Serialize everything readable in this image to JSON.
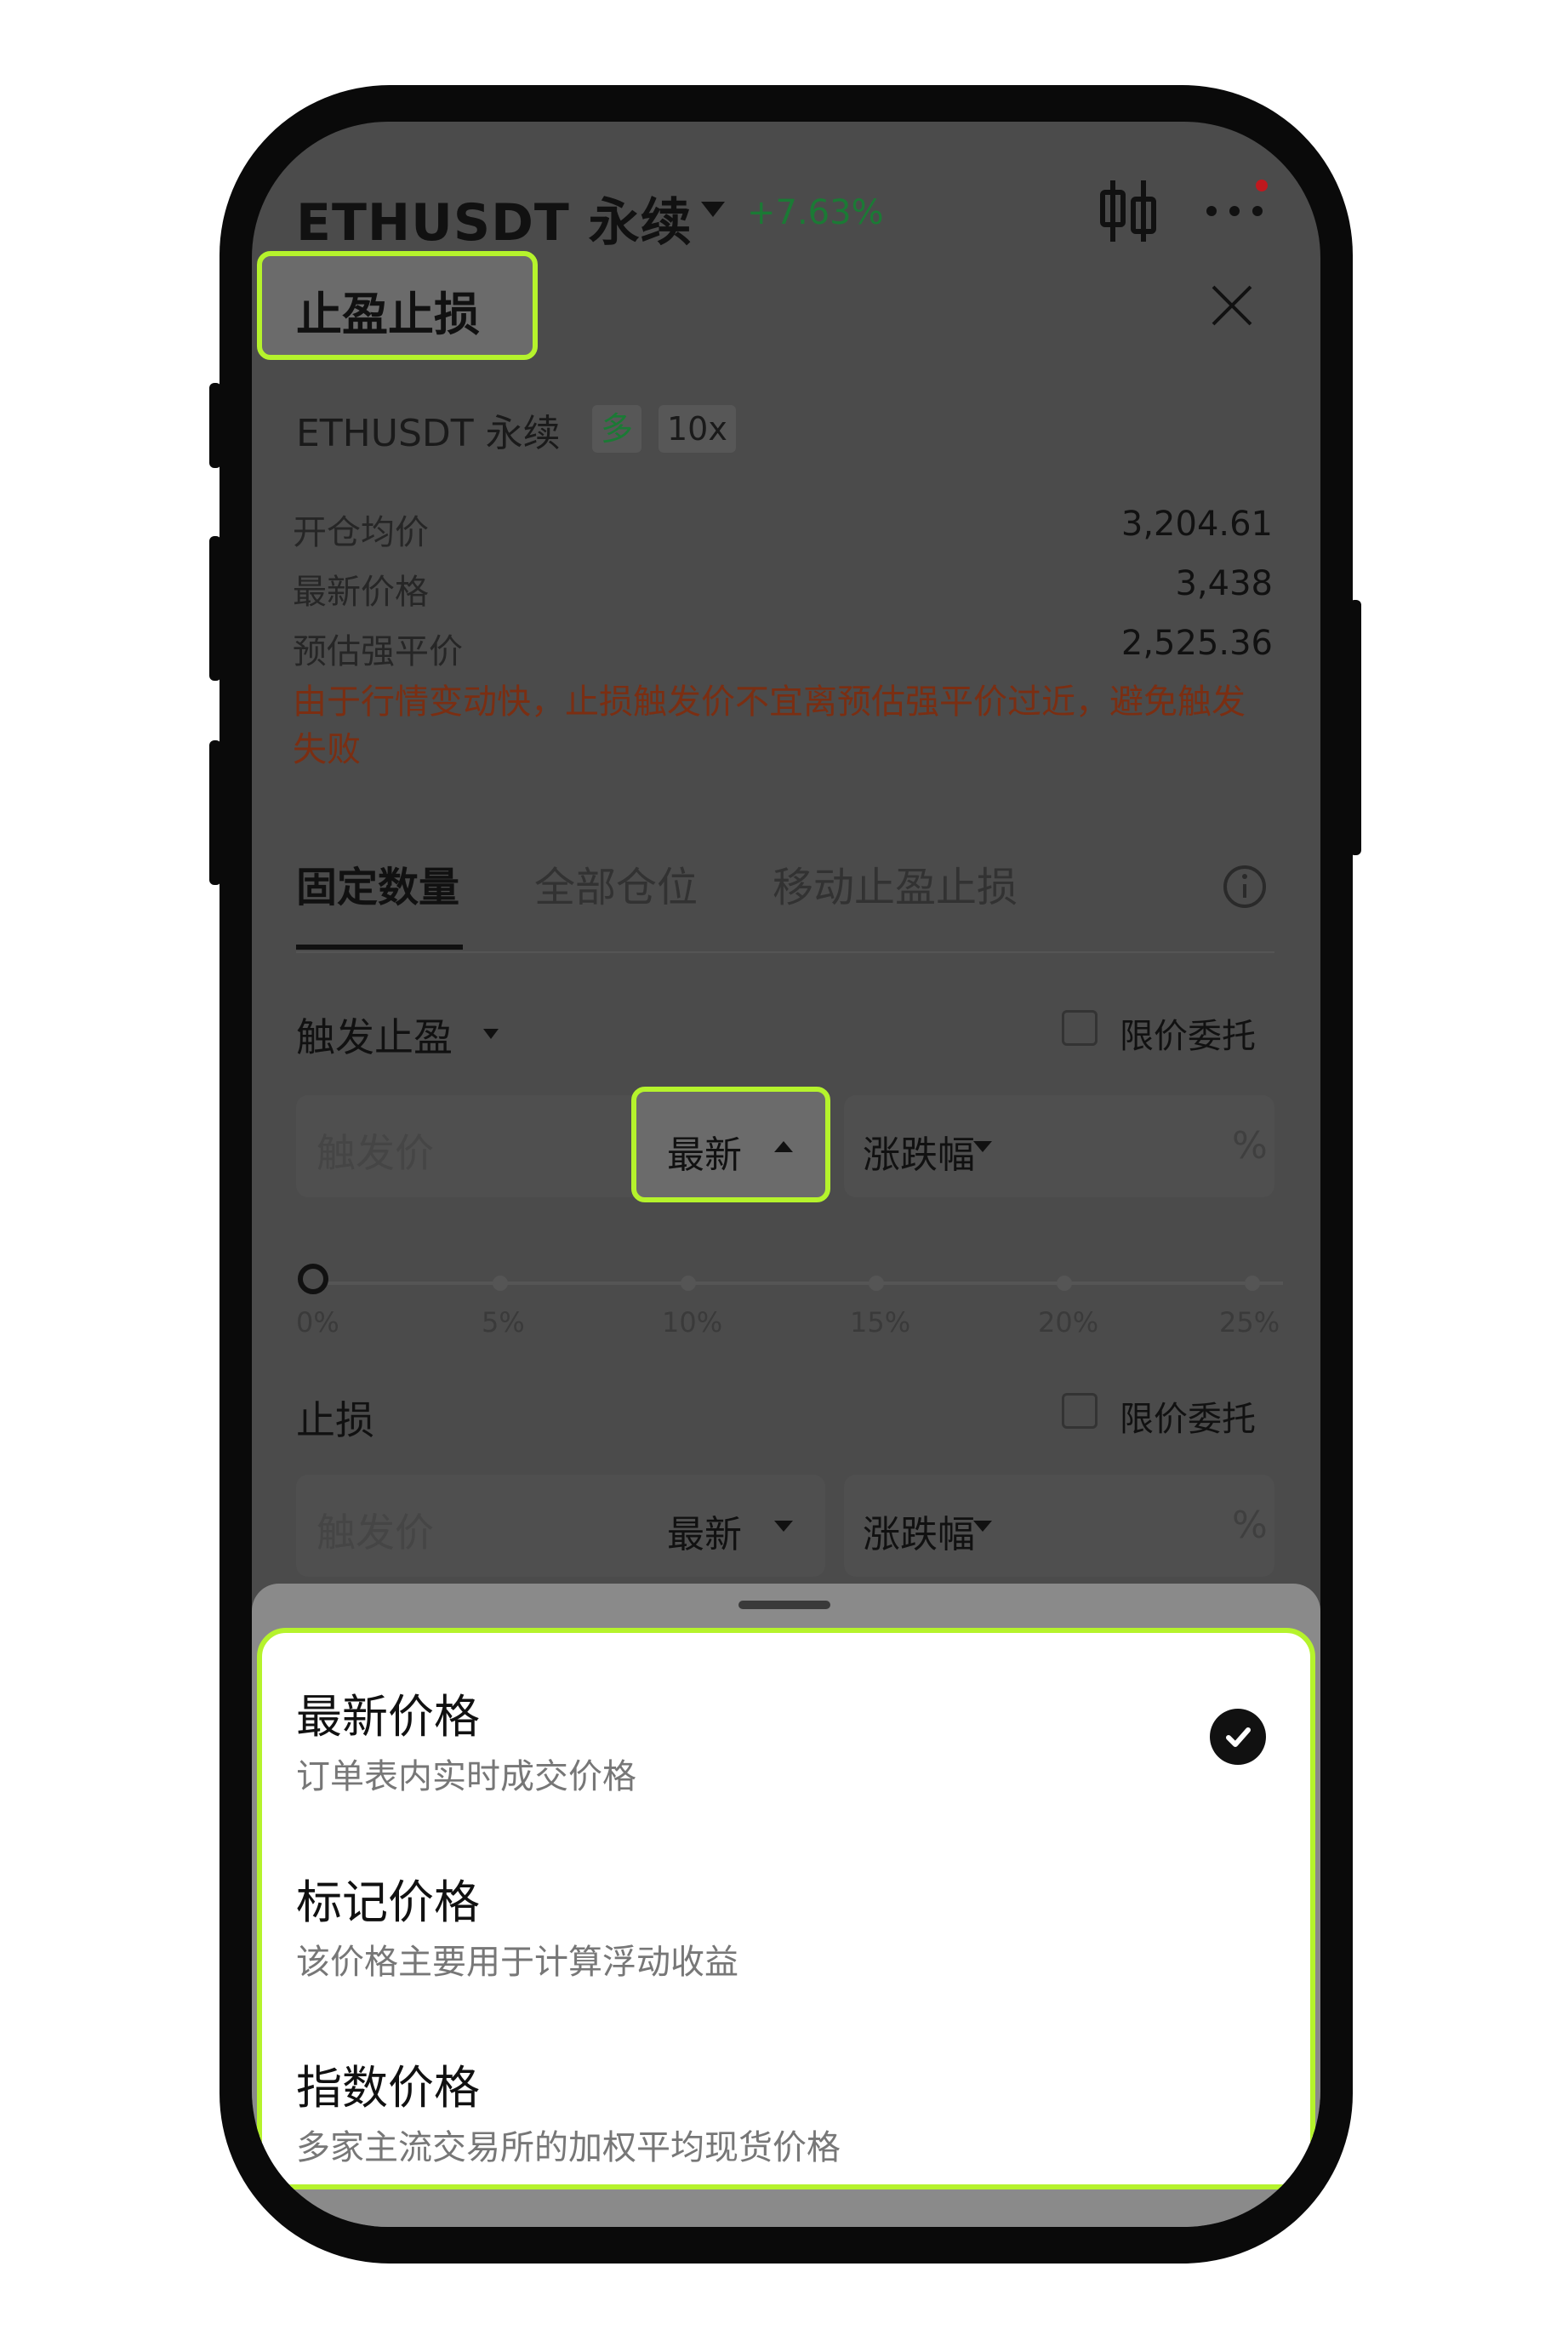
{
  "header": {
    "title": "ETHUSDT 永续",
    "change": "+7.63%"
  },
  "panel_title": "止盈止损",
  "position": {
    "symbol": "ETHUSDT 永续",
    "side": "多",
    "leverage": "10x"
  },
  "info": [
    {
      "label": "开仓均价",
      "value": "3,204.61"
    },
    {
      "label": "最新价格",
      "value": "3,438"
    },
    {
      "label": "预估强平价",
      "value": "2,525.36"
    }
  ],
  "warning": "由于行情变动快，止损触发价不宜离预估强平价过近，避免触发失败",
  "tabs": [
    "固定数量",
    "全部仓位",
    "移动止盈止损"
  ],
  "take_profit": {
    "title": "触发止盈",
    "limit_label": "限价委托",
    "trigger_placeholder": "触发价",
    "price_type": "最新",
    "mode": "涨跌幅",
    "unit": "%"
  },
  "slider_marks": [
    "0%",
    "5%",
    "10%",
    "15%",
    "20%",
    "25%"
  ],
  "stop_loss": {
    "title": "止损",
    "limit_label": "限价委托",
    "trigger_placeholder": "触发价",
    "price_type": "最新",
    "mode": "涨跌幅",
    "unit": "%"
  },
  "sheet_options": [
    {
      "title": "最新价格",
      "desc": "订单表内实时成交价格",
      "selected": true
    },
    {
      "title": "标记价格",
      "desc": "该价格主要用于计算浮动收益",
      "selected": false
    },
    {
      "title": "指数价格",
      "desc": "多家主流交易所的加权平均现货价格",
      "selected": false
    }
  ],
  "colors": {
    "highlight": "#b5f32c",
    "positive": "#1b7a35",
    "warning": "#7b2e12"
  }
}
